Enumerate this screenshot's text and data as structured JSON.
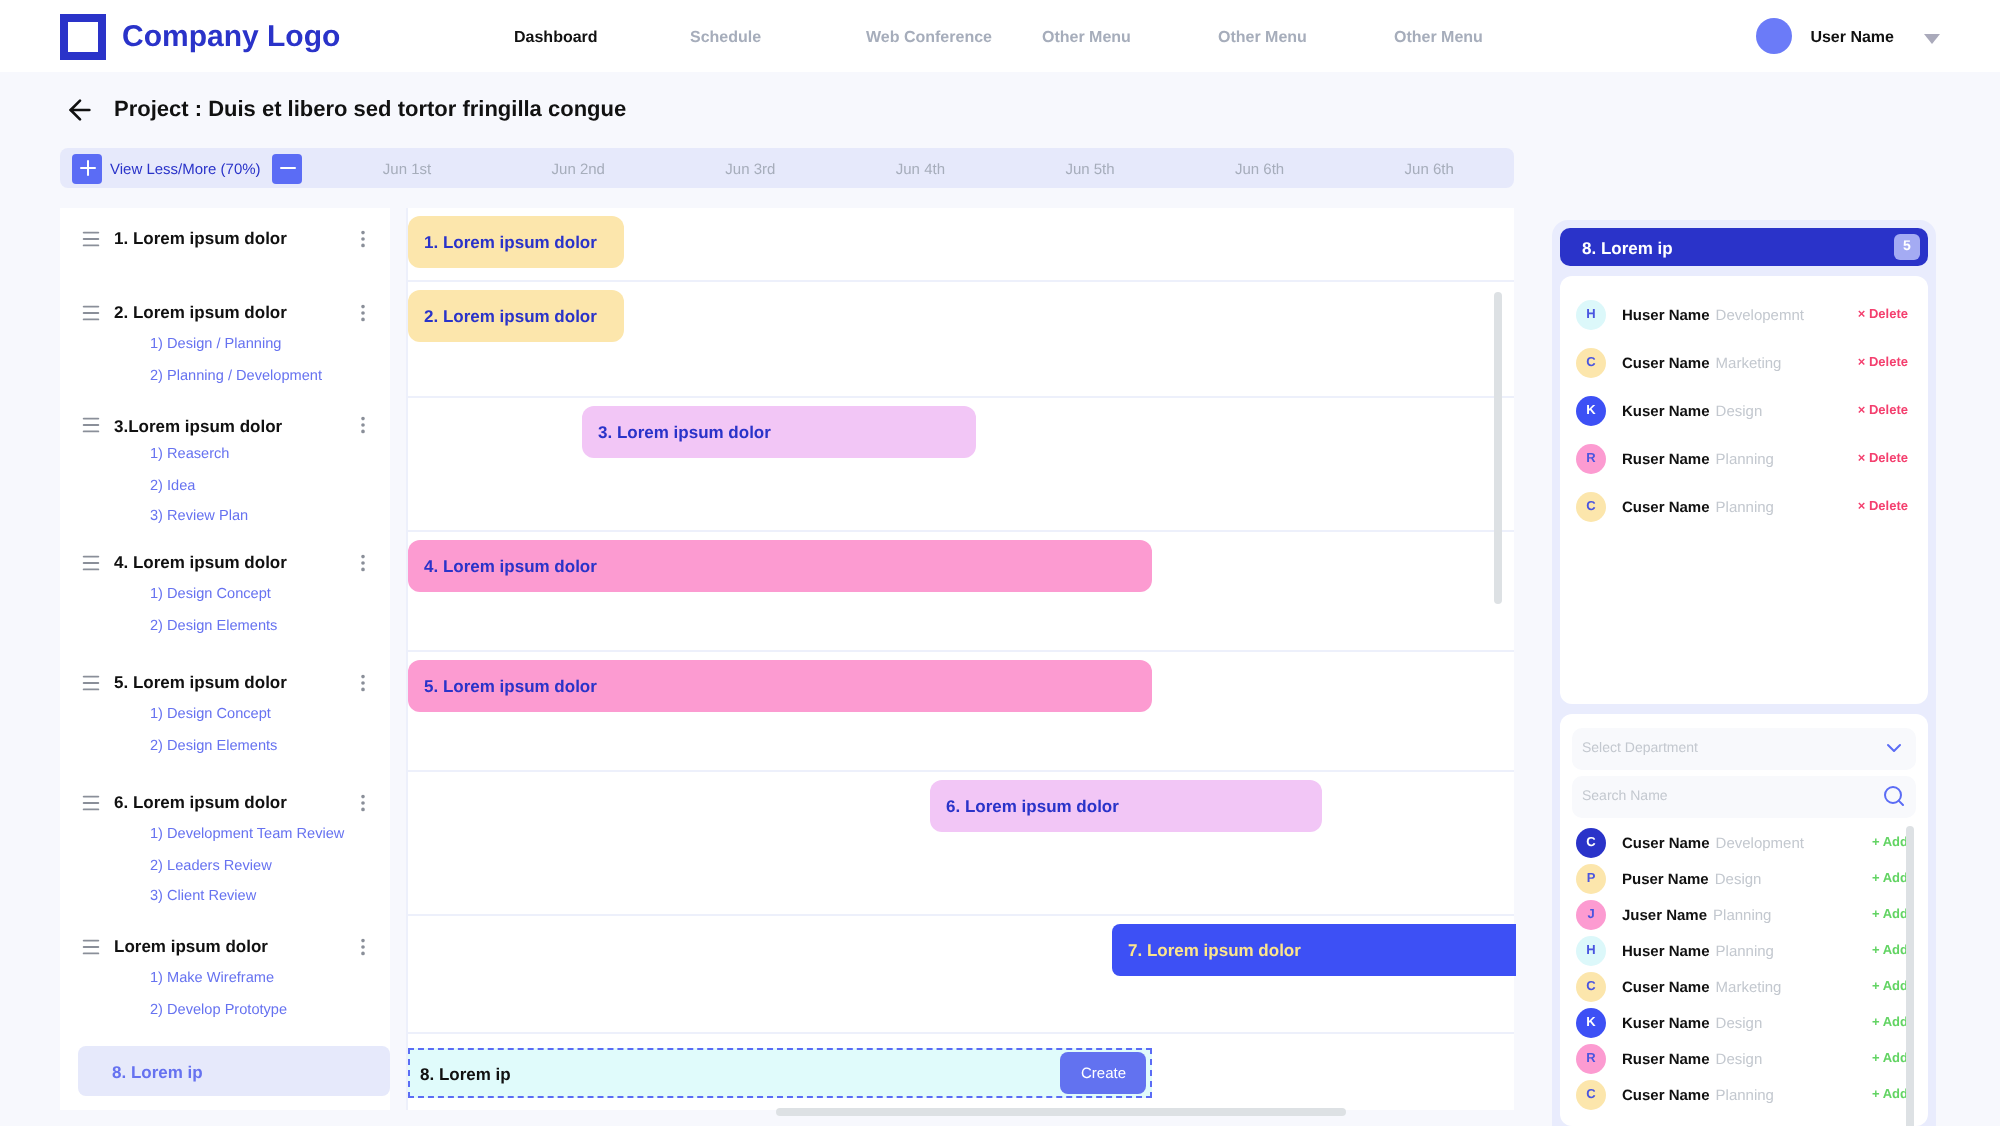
{
  "logo": {
    "text": "Company Logo"
  },
  "nav": [
    {
      "label": "Dashboard",
      "selected": true
    },
    {
      "label": "Schedule",
      "selected": false
    },
    {
      "label": "Web Conference",
      "selected": false
    },
    {
      "label": "Other Menu",
      "selected": false
    },
    {
      "label": "Other Menu",
      "selected": false
    },
    {
      "label": "Other Menu",
      "selected": false
    }
  ],
  "user": {
    "name": "User Name"
  },
  "project_title": "Project : Duis et libero sed tortor fringilla congue",
  "timeline": {
    "zoom_label": "View Less/More (70%)",
    "days": [
      "Jun 1st",
      "Jun 2nd",
      "Jun 3rd",
      "Jun 4th",
      "Jun 5th",
      "Jun 6th",
      "Jun 6th"
    ]
  },
  "tasks": [
    {
      "title": "1. Lorem ipsum dolor",
      "bar": {
        "label": "1. Lorem ipsum dolor",
        "color": "#fce6ac"
      }
    },
    {
      "title": "2. Lorem ipsum dolor",
      "subtasks": [
        "1) Design / Planning",
        "2) Planning / Development"
      ],
      "bar": {
        "label": "2. Lorem ipsum dolor",
        "color": "#fce6ac"
      }
    },
    {
      "title": "3.Lorem ipsum dolor",
      "subtasks": [
        "1) Reaserch",
        "2) Idea",
        "3) Review Plan"
      ],
      "bar": {
        "label": "3. Lorem ipsum dolor",
        "color": "#f2c6f6"
      }
    },
    {
      "title": "4. Lorem ipsum dolor",
      "subtasks": [
        "1) Design Concept",
        "2) Design Elements"
      ],
      "bar": {
        "label": "4. Lorem ipsum dolor",
        "color": "#fc9bd1"
      }
    },
    {
      "title": "5. Lorem ipsum dolor",
      "subtasks": [
        "1) Design Concept",
        "2) Design Elements"
      ],
      "bar": {
        "label": "5. Lorem ipsum dolor",
        "color": "#fc9bd1"
      }
    },
    {
      "title": "6. Lorem ipsum dolor",
      "subtasks": [
        "1) Development Team Review",
        "2) Leaders Review",
        "3) Client Review"
      ],
      "bar": {
        "label": "6. Lorem ipsum dolor",
        "color": "#f2c6f6"
      }
    },
    {
      "title": "Lorem ipsum dolor",
      "subtasks": [
        "1) Make Wireframe",
        "2) Develop Prototype"
      ],
      "bar": {
        "label": "7. Lorem ipsum dolor",
        "color": "#3d50f5"
      }
    }
  ],
  "new_task": {
    "label": "8. Lorem ip",
    "value": "8. Lorem ip",
    "button": "Create"
  },
  "team_panel": {
    "title": "8. Lorem ip",
    "count": "5",
    "members": [
      {
        "initial": "H",
        "name": "Huser Name",
        "department": "Developemnt",
        "color": "#dcf8fa",
        "action": "× Delete"
      },
      {
        "initial": "C",
        "name": "Cuser Name",
        "department": "Marketing",
        "color": "#fce6ac",
        "action": "× Delete"
      },
      {
        "initial": "K",
        "name": "Kuser Name",
        "department": "Design",
        "color": "#3d50f5",
        "action": "× Delete"
      },
      {
        "initial": "R",
        "name": "Ruser Name",
        "department": "Planning",
        "color": "#fc9bd1",
        "action": "× Delete"
      },
      {
        "initial": "C",
        "name": "Cuser Name",
        "department": "Planning",
        "color": "#fce6ac",
        "action": "× Delete"
      }
    ]
  },
  "directory": {
    "department_placeholder": "Select Department",
    "search_placeholder": "Search Name",
    "people": [
      {
        "initial": "C",
        "name": "Cuser Name",
        "department": "Development",
        "color": "#2a33c9",
        "action": "+ Add"
      },
      {
        "initial": "P",
        "name": "Puser Name",
        "department": "Design",
        "color": "#fce6ac",
        "action": "+ Add"
      },
      {
        "initial": "J",
        "name": "Juser Name",
        "department": "Planning",
        "color": "#fc9bd1",
        "action": "+ Add"
      },
      {
        "initial": "H",
        "name": "Huser Name",
        "department": "Planning",
        "color": "#dcf8fa",
        "action": "+ Add"
      },
      {
        "initial": "C",
        "name": "Cuser Name",
        "department": "Marketing",
        "color": "#fce6ac",
        "action": "+ Add"
      },
      {
        "initial": "K",
        "name": "Kuser Name",
        "department": "Design",
        "color": "#3d50f5",
        "action": "+ Add"
      },
      {
        "initial": "R",
        "name": "Ruser Name",
        "department": "Design",
        "color": "#fc9bd1",
        "action": "+ Add"
      },
      {
        "initial": "C",
        "name": "Cuser Name",
        "department": "Planning",
        "color": "#fce6ac",
        "action": "+ Add"
      }
    ]
  }
}
